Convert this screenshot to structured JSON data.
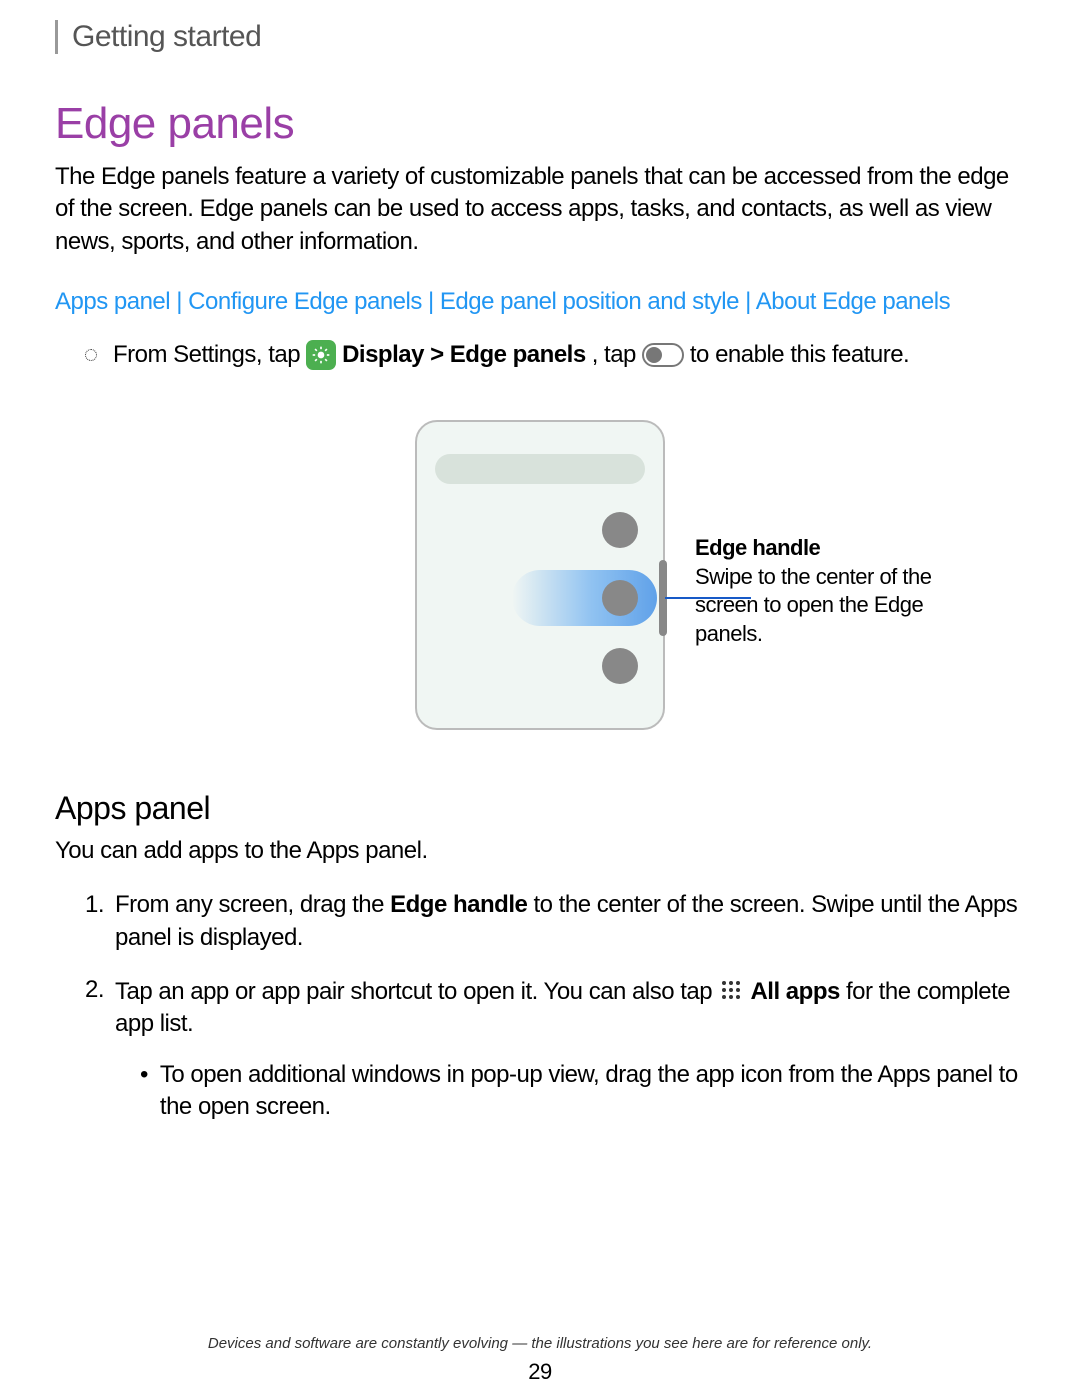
{
  "breadcrumb": "Getting started",
  "h1": "Edge panels",
  "intro": "The Edge panels feature a variety of customizable panels that can be accessed from the edge of the screen. Edge panels can be used to access apps, tasks, and contacts, as well as view news, sports, and other information.",
  "links": {
    "apps_panel": "Apps panel",
    "configure": "Configure Edge panels",
    "position": "Edge panel position and style",
    "about": "About Edge panels"
  },
  "step": {
    "pre": "From Settings, tap",
    "bold": " Display > Edge panels",
    "mid": ", tap",
    "post": " to enable this feature."
  },
  "callout": {
    "title": "Edge handle",
    "body": "Swipe to the center of the screen to open the Edge panels."
  },
  "h2": "Apps panel",
  "p2": "You can add apps to the Apps panel.",
  "ol": {
    "item1": {
      "pre": "From any screen, drag the ",
      "bold": "Edge handle",
      "post": " to the center of the screen. Swipe until the Apps panel is displayed."
    },
    "item2": {
      "pre": "Tap an app or app pair shortcut to open it. You can also tap",
      "bold": " All apps",
      "post": " for the complete app list.",
      "sub": "To open additional windows in pop-up view, drag the app icon from the Apps panel to the open screen."
    }
  },
  "footer": "Devices and software are constantly evolving — the illustrations you see here are for reference only.",
  "page": "29"
}
